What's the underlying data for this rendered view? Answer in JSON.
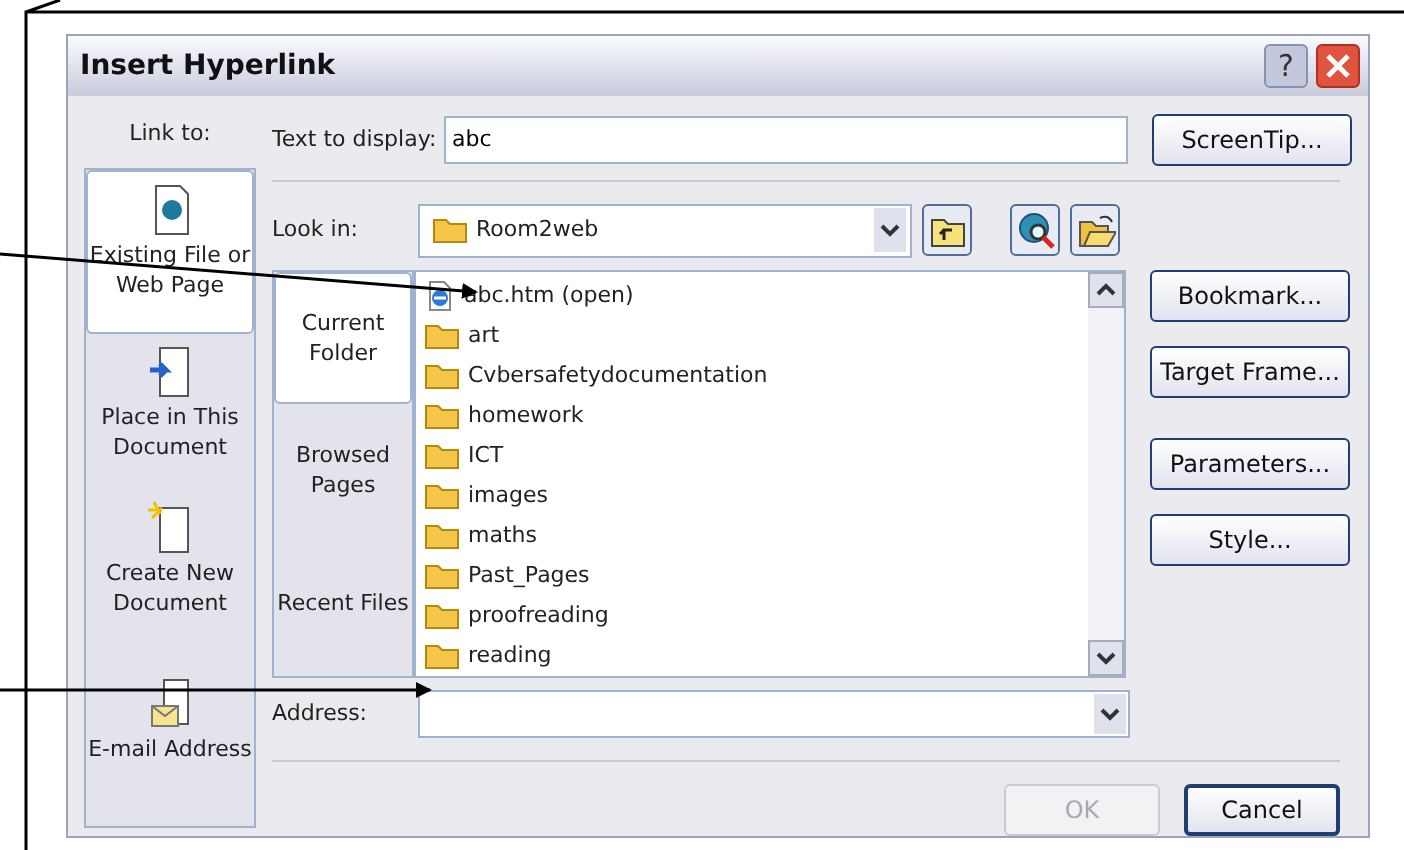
{
  "window": {
    "title": "Insert Hyperlink"
  },
  "title_buttons": [
    {
      "kind": "help",
      "label": "?"
    },
    {
      "kind": "close"
    }
  ],
  "link_to": {
    "label": "Link to:",
    "items": [
      {
        "label": "Existing File or Web Page",
        "kind": "file",
        "selected": true
      },
      {
        "label": "Place in This Document",
        "kind": "place",
        "selected": false
      },
      {
        "label": "Create New Document",
        "kind": "new",
        "selected": false
      },
      {
        "label": "E-mail Address",
        "kind": "email",
        "selected": false
      }
    ]
  },
  "text_to_display": {
    "label": "Text to display:",
    "value": "abc"
  },
  "screentip_button": "ScreenTip...",
  "look_in": {
    "label": "Look in:",
    "value": "Room2web"
  },
  "toolbar": [
    {
      "kind": "up-folder"
    },
    {
      "kind": "web-search"
    },
    {
      "kind": "browse-folder"
    }
  ],
  "nav": [
    {
      "label": "Current Folder",
      "selected": true
    },
    {
      "label": "Browsed Pages",
      "selected": false
    },
    {
      "label": "Recent Files",
      "selected": false
    }
  ],
  "files": [
    {
      "name": "abc.htm (open)",
      "kind": "web"
    },
    {
      "name": "art",
      "kind": "folder"
    },
    {
      "name": "Cvbersafetydocumentation",
      "kind": "folder"
    },
    {
      "name": "homework",
      "kind": "folder"
    },
    {
      "name": "ICT",
      "kind": "folder"
    },
    {
      "name": "images",
      "kind": "folder"
    },
    {
      "name": "maths",
      "kind": "folder"
    },
    {
      "name": "Past_Pages",
      "kind": "folder"
    },
    {
      "name": "proofreading",
      "kind": "folder"
    },
    {
      "name": "reading",
      "kind": "folder"
    }
  ],
  "side_buttons": [
    "Bookmark...",
    "Target Frame...",
    "Parameters...",
    "Style..."
  ],
  "address": {
    "label": "Address:"
  },
  "buttons": [
    {
      "label": "OK",
      "disabled": true
    },
    {
      "label": "Cancel",
      "disabled": false
    }
  ]
}
